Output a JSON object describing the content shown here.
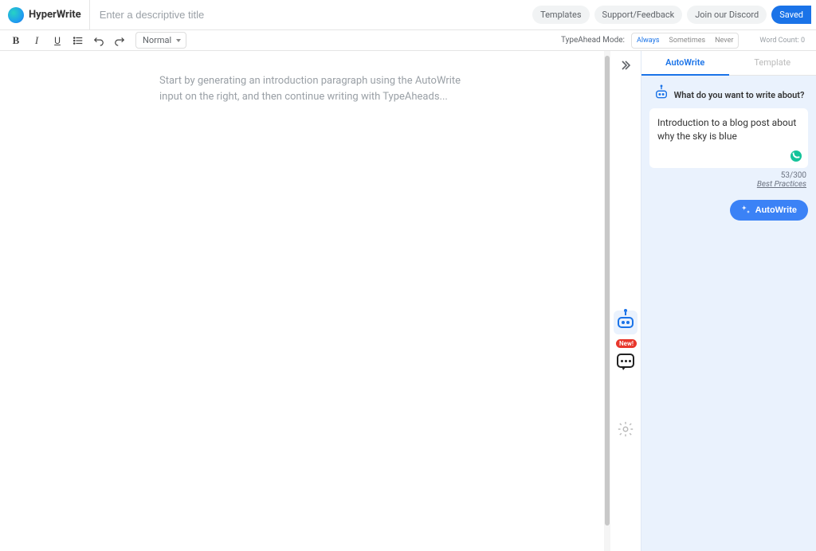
{
  "brand": "HyperWrite",
  "title_placeholder": "Enter a descriptive title",
  "header_buttons": {
    "templates": "Templates",
    "support": "Support/Feedback",
    "discord": "Join our Discord",
    "saved": "Saved"
  },
  "toolbar": {
    "format": "Normal",
    "typeahead_label": "TypeAhead Mode:",
    "modes": {
      "always": "Always",
      "sometimes": "Sometimes",
      "never": "Never"
    },
    "wordcount_label": "Word Count: 0"
  },
  "editor": {
    "placeholder": "Start by generating an introduction paragraph using the AutoWrite input on the right, and then continue writing with TypeAheads..."
  },
  "dock": {
    "new_badge": "New!"
  },
  "sidepanel": {
    "tabs": {
      "autowrite": "AutoWrite",
      "template": "Template"
    },
    "prompt_heading": "What do you want to write about?",
    "input_value": "Introduction to a blog post about why the sky is blue",
    "counter": "53/300",
    "best_practices": "Best Practices",
    "autowrite_button": "AutoWrite"
  }
}
